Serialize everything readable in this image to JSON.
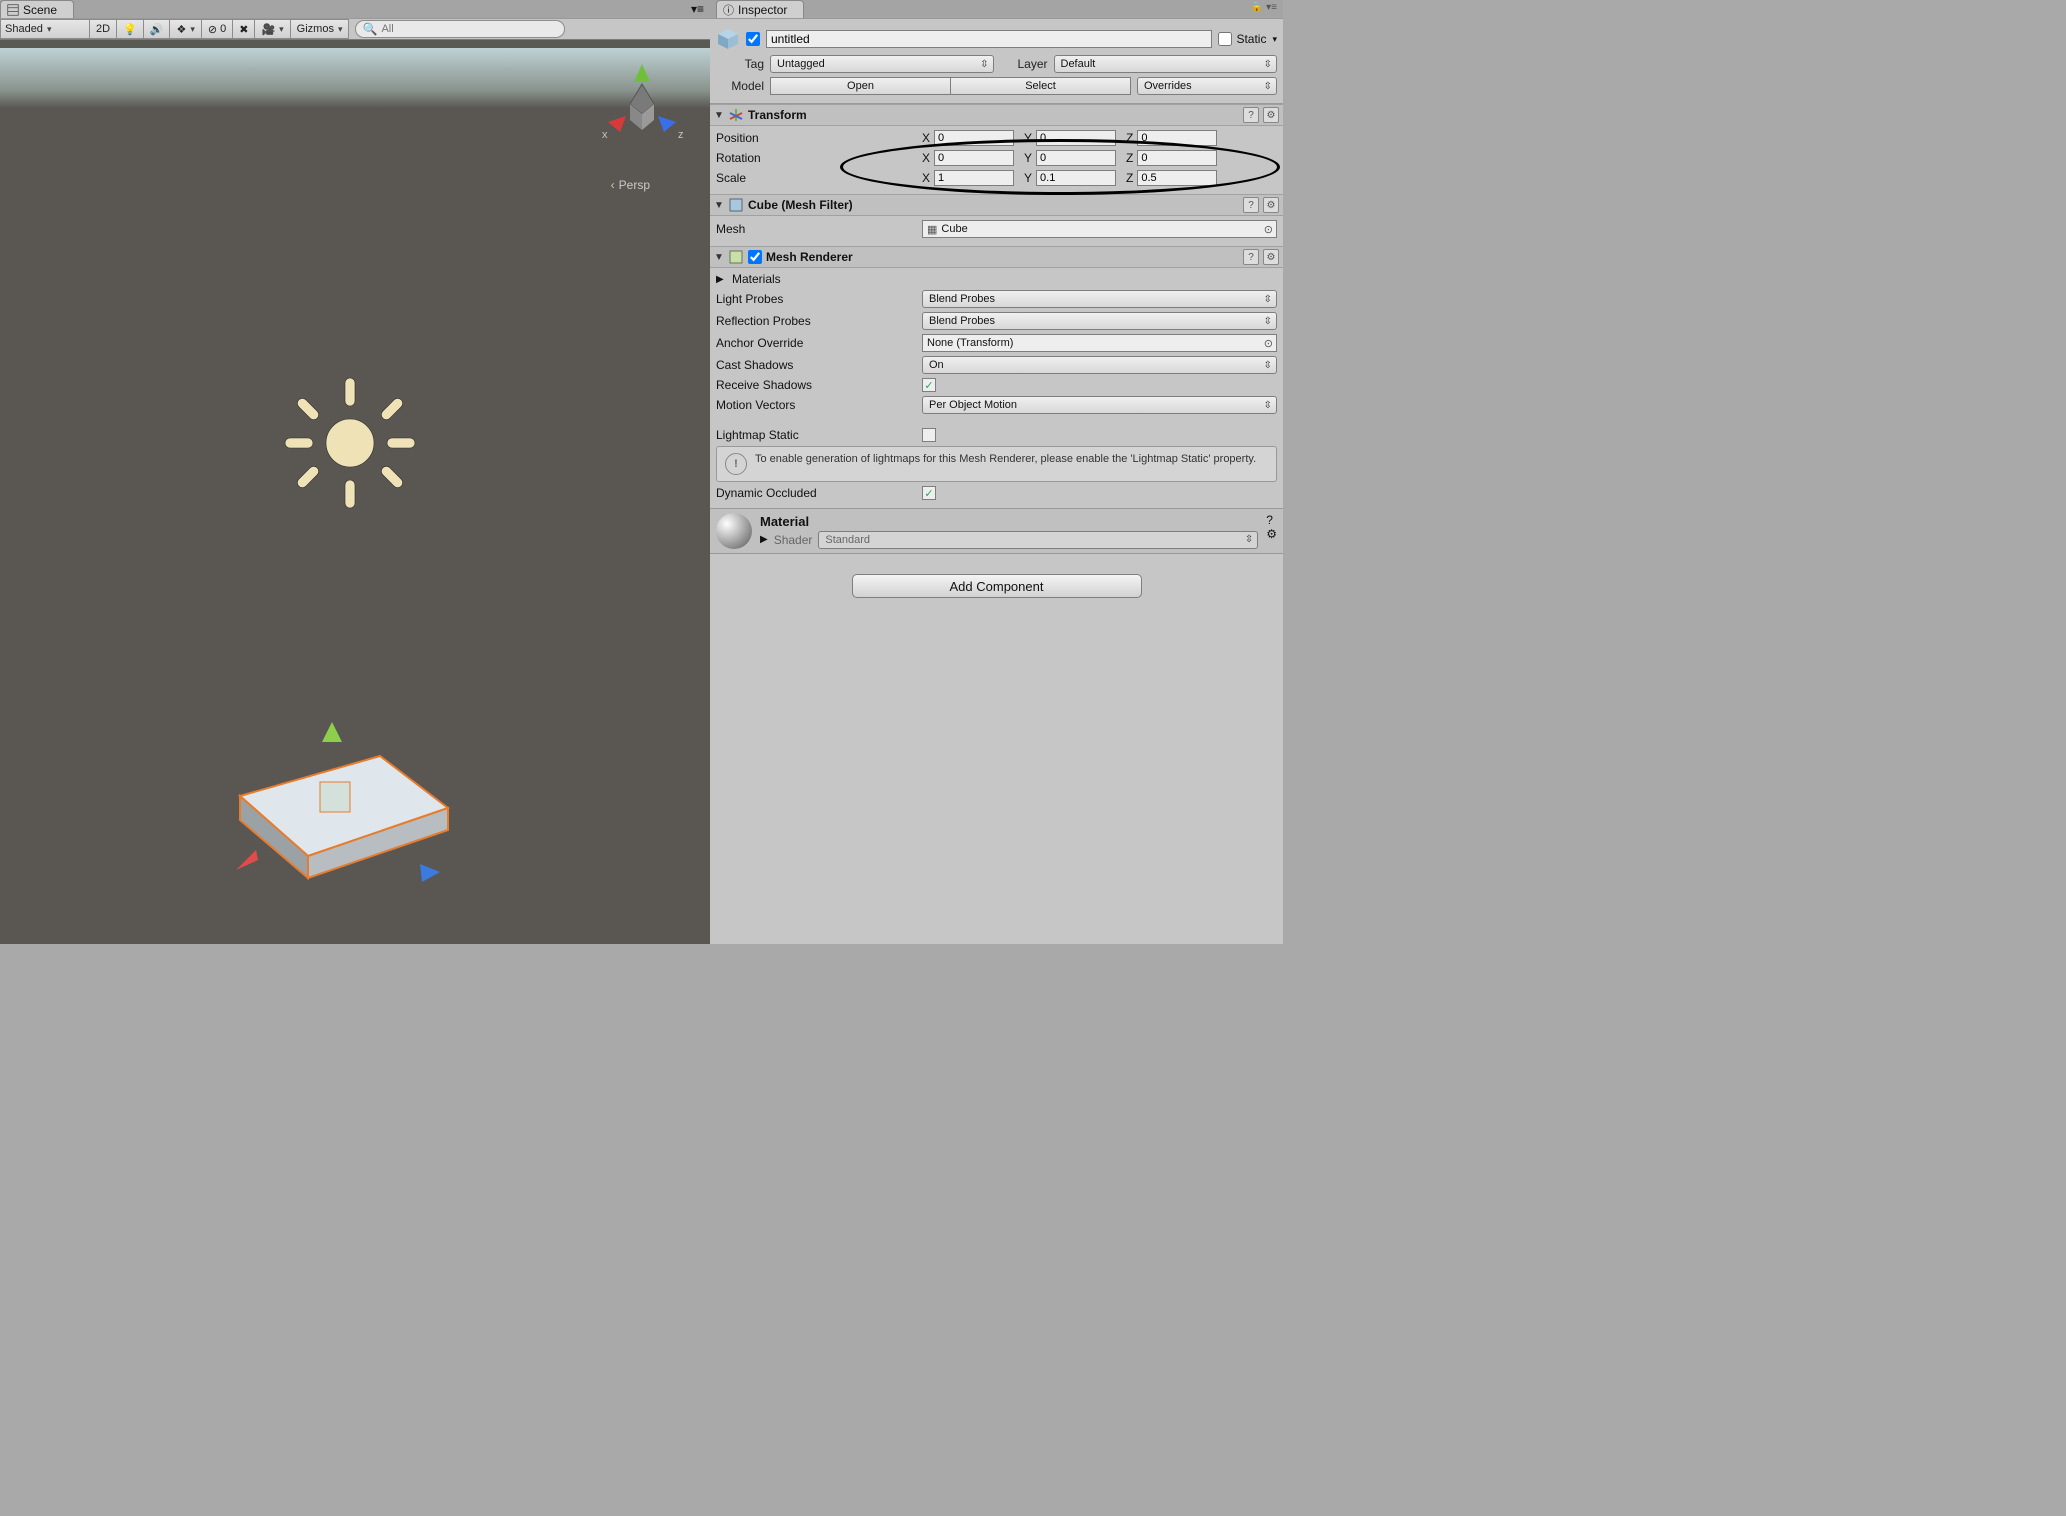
{
  "scene": {
    "tab_label": "Scene",
    "toolbar": {
      "shading": "Shaded",
      "btn_2d": "2D",
      "eye_count": "0",
      "gizmos_label": "Gizmos",
      "search_placeholder": "All"
    },
    "camera_label": "Persp"
  },
  "inspector": {
    "tab_label": "Inspector",
    "header": {
      "name": "untitled",
      "enabled_checked": true,
      "static_label": "Static",
      "tag_label": "Tag",
      "tag_value": "Untagged",
      "layer_label": "Layer",
      "layer_value": "Default",
      "model_label": "Model",
      "btn_open": "Open",
      "btn_select": "Select",
      "btn_overrides": "Overrides"
    },
    "transform": {
      "title": "Transform",
      "position_label": "Position",
      "rotation_label": "Rotation",
      "scale_label": "Scale",
      "position": {
        "x": "0",
        "y": "0",
        "z": "0"
      },
      "rotation": {
        "x": "0",
        "y": "0",
        "z": "0"
      },
      "scale": {
        "x": "1",
        "y": "0.1",
        "z": "0.5"
      }
    },
    "mesh_filter": {
      "title": "Cube (Mesh Filter)",
      "mesh_label": "Mesh",
      "mesh_value": "Cube"
    },
    "mesh_renderer": {
      "title": "Mesh Renderer",
      "materials_label": "Materials",
      "light_probes": {
        "label": "Light Probes",
        "value": "Blend Probes"
      },
      "reflection_probes": {
        "label": "Reflection Probes",
        "value": "Blend Probes"
      },
      "anchor_override": {
        "label": "Anchor Override",
        "value": "None (Transform)"
      },
      "cast_shadows": {
        "label": "Cast Shadows",
        "value": "On"
      },
      "receive_shadows": {
        "label": "Receive Shadows",
        "checked": true
      },
      "motion_vectors": {
        "label": "Motion Vectors",
        "value": "Per Object Motion"
      },
      "lightmap_static": {
        "label": "Lightmap Static",
        "checked": false
      },
      "info": "To enable generation of lightmaps for this Mesh Renderer, please enable the 'Lightmap Static' property.",
      "dynamic_occluded": {
        "label": "Dynamic Occluded",
        "checked": true
      }
    },
    "material": {
      "title": "Material",
      "shader_label": "Shader",
      "shader_value": "Standard"
    },
    "add_component": "Add Component"
  }
}
